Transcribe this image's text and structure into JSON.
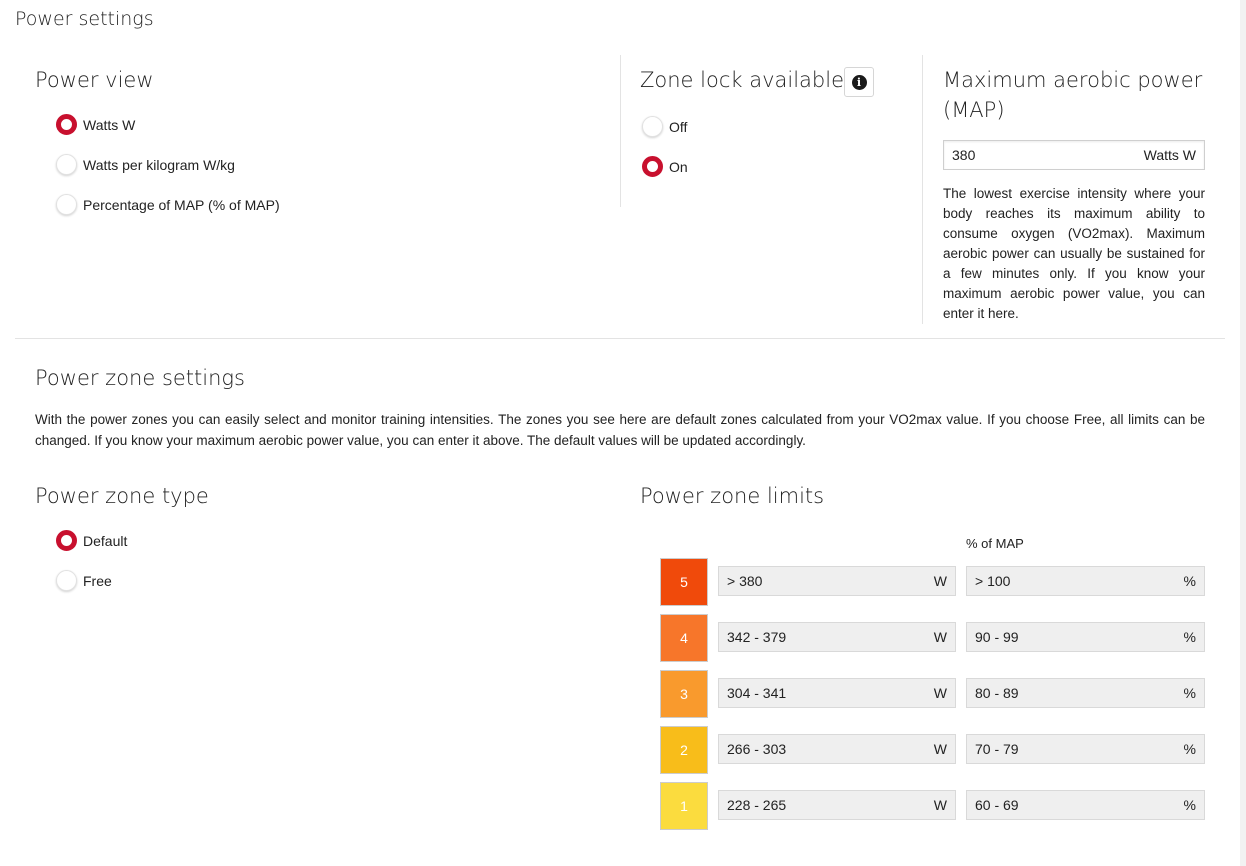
{
  "page_title": "Power settings",
  "power_view": {
    "title": "Power view",
    "options": [
      {
        "label": "Watts W",
        "checked": true
      },
      {
        "label": "Watts per kilogram W/kg",
        "checked": false
      },
      {
        "label": "Percentage of MAP (% of MAP)",
        "checked": false
      }
    ]
  },
  "zone_lock": {
    "title": "Zone lock available",
    "info_icon": "i",
    "options": [
      {
        "label": "Off",
        "checked": false
      },
      {
        "label": "On",
        "checked": true
      }
    ]
  },
  "map": {
    "title_line1": "Maximum aerobic power",
    "title_line2": "(MAP)",
    "value": "380",
    "unit": "Watts W",
    "description": "The lowest exercise intensity where your body reaches its maximum ability to consume oxygen (VO2max). Maximum aerobic power can usually be sustained for a few minutes only. If you know your maximum aerobic power value, you can enter it here."
  },
  "power_zone_settings": {
    "title": "Power zone settings",
    "description": "With the power zones you can easily select and monitor training intensities. The zones you see here are default zones calculated from your VO2max value. If you choose Free, all limits can be changed. If you know your maximum aerobic power value, you can enter it above. The default values will be updated accordingly."
  },
  "zone_type": {
    "title": "Power zone type",
    "options": [
      {
        "label": "Default",
        "checked": true
      },
      {
        "label": "Free",
        "checked": false
      }
    ]
  },
  "zone_limits": {
    "title": "Power zone limits",
    "pct_header": "% of MAP",
    "watts_unit": "W",
    "pct_unit": "%",
    "zones": [
      {
        "number": "5",
        "watts": "> 380",
        "pct": "> 100",
        "color": "#f04a0b"
      },
      {
        "number": "4",
        "watts": "342 - 379",
        "pct": "90 - 99",
        "color": "#f7762a"
      },
      {
        "number": "3",
        "watts": "304 - 341",
        "pct": "80 - 89",
        "color": "#f99a2d"
      },
      {
        "number": "2",
        "watts": "266 - 303",
        "pct": "70 - 79",
        "color": "#f8bd1a"
      },
      {
        "number": "1",
        "watts": "228 - 265",
        "pct": "60 - 69",
        "color": "#fbdc3e"
      }
    ]
  },
  "colors": {
    "accent": "#c8102e"
  }
}
